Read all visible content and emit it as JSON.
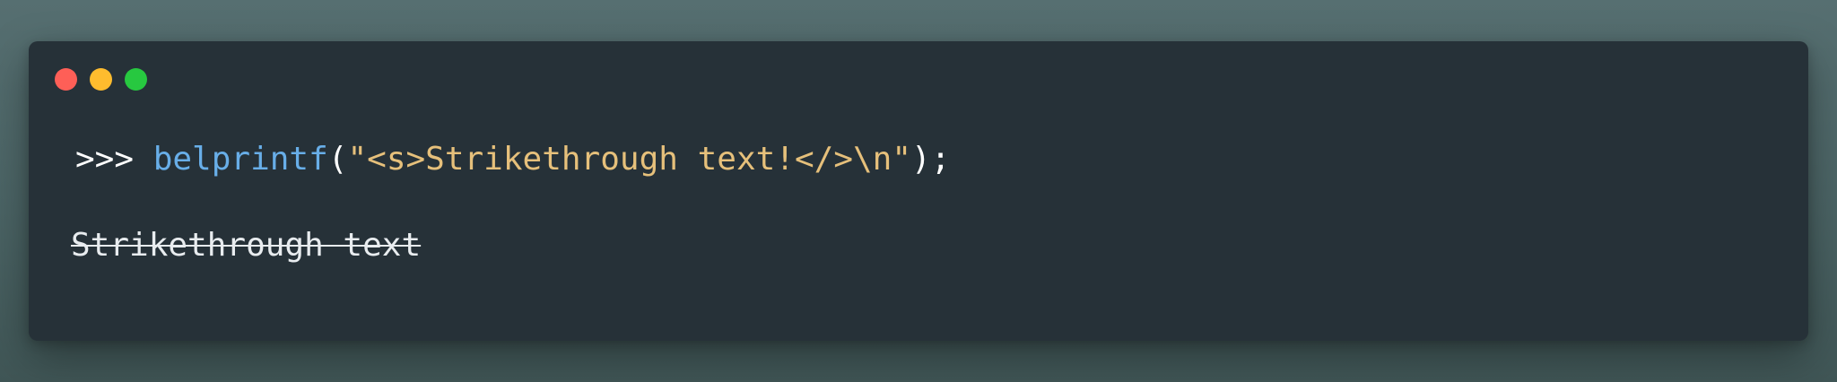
{
  "window": {
    "controls": {
      "close_color": "#fe5f57",
      "minimize_color": "#febc2e",
      "zoom_color": "#27c840"
    }
  },
  "terminal": {
    "prompt": ">>> ",
    "function_name": "belprintf",
    "open_paren": "(",
    "string_literal": "\"<s>Strikethrough text!</>\\n\"",
    "close_paren": ")",
    "semicolon": ";",
    "output": "Strikethrough text"
  },
  "colors": {
    "background": "#263138",
    "function": "#68aee8",
    "string": "#e6c07b",
    "text": "#e8ecef"
  }
}
